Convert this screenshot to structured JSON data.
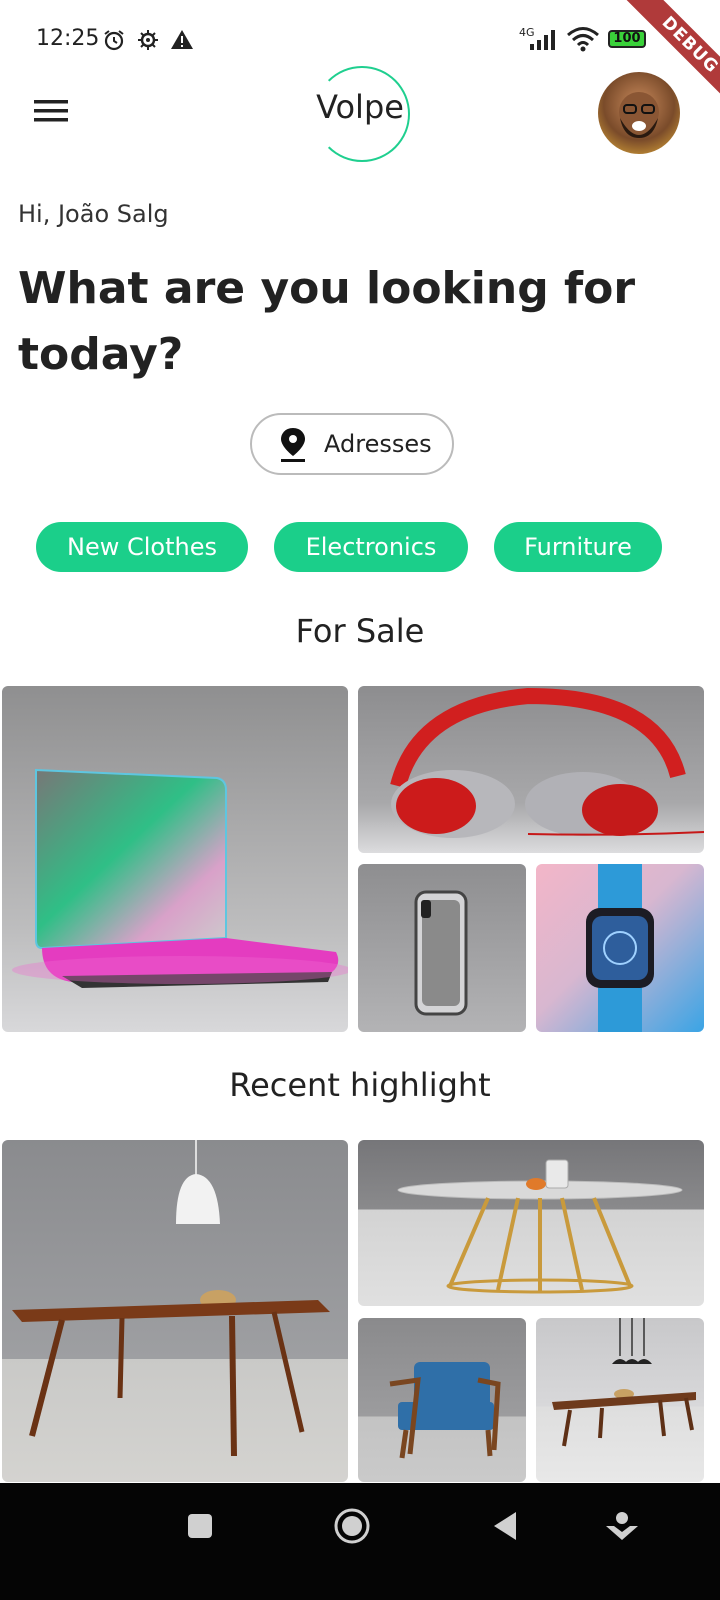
{
  "status_bar": {
    "time": "12:25",
    "network": "4G",
    "battery": "100",
    "debug_banner": "DEBUG"
  },
  "app_bar": {
    "logo": "Volpe",
    "menu_icon": "hamburger-menu-icon",
    "avatar": "user-avatar"
  },
  "greeting": "Hi, João Salg",
  "headline": "What are you looking for today?",
  "address_button": {
    "label": "Adresses",
    "icon": "location-pin-icon"
  },
  "categories": [
    "New Clothes",
    "Electronics",
    "Furniture"
  ],
  "sections": {
    "for_sale": {
      "title": "For Sale",
      "items": [
        "laptop",
        "headphones",
        "smartphone",
        "smartwatch"
      ]
    },
    "recent_highlight": {
      "title": "Recent highlight",
      "items": [
        "dining-table-pendant",
        "round-table",
        "armchair",
        "long-table"
      ]
    }
  },
  "nav_bar": {
    "icons": [
      "recents-square-icon",
      "home-circle-icon",
      "back-triangle-icon",
      "assistant-icon"
    ]
  },
  "colors": {
    "accent": "#1bcf8a",
    "debug": "#b03a3a"
  }
}
